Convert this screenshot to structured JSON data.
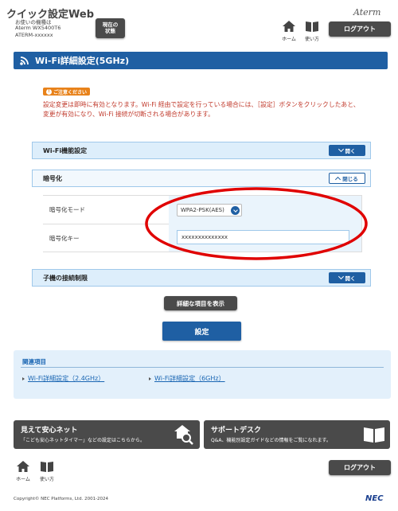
{
  "header": {
    "app_title": "クイック設定Web",
    "device_caption": "お使いの機種は",
    "device_model": "Aterm WX5400T6",
    "device_name": "ATERM-xxxxxx",
    "status_button": "現在の状態",
    "logo": "Aterm",
    "home_label": "ホーム",
    "help_label": "使い方",
    "logout": "ログアウト"
  },
  "page_title": "Wi-Fi詳細設定(5GHz)",
  "notice": {
    "badge": "ご注意ください",
    "text": "設定変更は即時に有効となります。Wi-Fi 経由で設定を行っている場合には、［設定］ボタンをクリックしたあと、変更が有効になり、Wi-Fi 接続が切断される場合があります。"
  },
  "sections": {
    "wifi_function": {
      "label": "Wi-Fi機能設定",
      "toggle": "開く"
    },
    "encryption": {
      "label": "暗号化",
      "toggle": "閉じる",
      "mode_label": "暗号化モード",
      "mode_value": "WPA2-PSK(AES)",
      "key_label": "暗号化キー",
      "key_value": "xxxxxxxxxxxxxx"
    },
    "child_limit": {
      "label": "子機の接続制限",
      "toggle": "開く"
    }
  },
  "buttons": {
    "show_details": "詳細な項目を表示",
    "apply": "設定"
  },
  "related": {
    "title": "関連項目",
    "links": [
      "Wi-Fi詳細設定（2.4GHz）",
      "Wi-Fi詳細設定（6GHz）"
    ]
  },
  "banners": {
    "safe_net": {
      "title": "見えて安心ネット",
      "sub": "「こども安心ネットタイマー」などの設定はこちらから。"
    },
    "support": {
      "title": "サポートデスク",
      "sub": "Q&A、機能別設定ガイドなどの情報をご覧になれます。"
    }
  },
  "footer": {
    "home_label": "ホーム",
    "help_label": "使い方",
    "logout": "ログアウト",
    "copyright": "Copyright© NEC Platforms, Ltd. 2001-2024",
    "brand": "NEC"
  },
  "colors": {
    "accent_blue": "#1f5fa3",
    "notice_red": "#c0392b",
    "highlight_red": "#e00000"
  }
}
